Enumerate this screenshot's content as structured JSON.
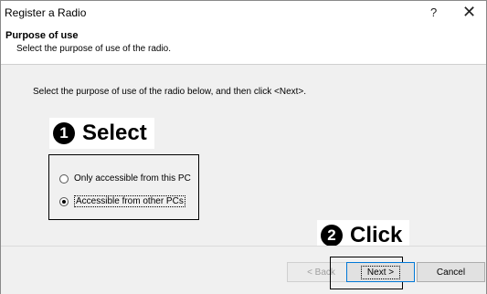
{
  "window": {
    "title": "Register a Radio",
    "help_label": "?",
    "close_label": "✕"
  },
  "header": {
    "title": "Purpose of use",
    "subtitle": "Select the purpose of use of the radio."
  },
  "body": {
    "instruction": "Select the purpose of use of the radio below, and then click <Next>."
  },
  "callouts": {
    "select_number": "1",
    "select_label": "Select",
    "click_number": "2",
    "click_label": "Click"
  },
  "options": [
    {
      "label": "Only accessible from this PC",
      "selected": false
    },
    {
      "label": "Accessible from other PCs",
      "selected": true
    }
  ],
  "buttons": {
    "back": "< Back",
    "next": "Next >",
    "cancel": "Cancel"
  }
}
